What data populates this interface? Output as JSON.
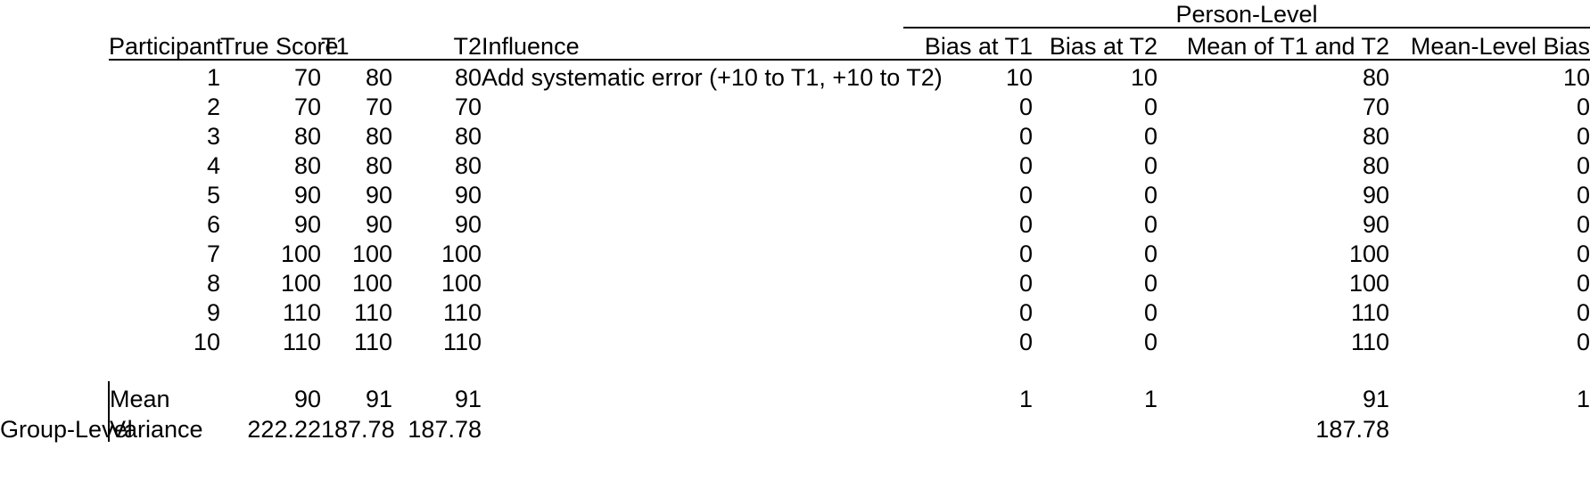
{
  "table": {
    "spanner": {
      "label": "Person-Level"
    },
    "columns": {
      "group_label": "",
      "participant": "Participant",
      "true_score": "True Score",
      "t1": "T1",
      "t2": "T2",
      "influence": "Influence",
      "bias_at_t1": "Bias at T1",
      "bias_at_t2": "Bias at T2",
      "mean_of_t1_and_t2": "Mean of T1 and T2",
      "mean_level_bias": "Mean-Level Bias"
    },
    "rows": [
      {
        "participant": "1",
        "true_score": "70",
        "t1": "80",
        "t2": "80",
        "influence": "Add systematic error (+10 to T1, +10 to T2)",
        "bias_at_t1": "10",
        "bias_at_t2": "10",
        "mean_of_t1_and_t2": "80",
        "mean_level_bias": "10"
      },
      {
        "participant": "2",
        "true_score": "70",
        "t1": "70",
        "t2": "70",
        "influence": "",
        "bias_at_t1": "0",
        "bias_at_t2": "0",
        "mean_of_t1_and_t2": "70",
        "mean_level_bias": "0"
      },
      {
        "participant": "3",
        "true_score": "80",
        "t1": "80",
        "t2": "80",
        "influence": "",
        "bias_at_t1": "0",
        "bias_at_t2": "0",
        "mean_of_t1_and_t2": "80",
        "mean_level_bias": "0"
      },
      {
        "participant": "4",
        "true_score": "80",
        "t1": "80",
        "t2": "80",
        "influence": "",
        "bias_at_t1": "0",
        "bias_at_t2": "0",
        "mean_of_t1_and_t2": "80",
        "mean_level_bias": "0"
      },
      {
        "participant": "5",
        "true_score": "90",
        "t1": "90",
        "t2": "90",
        "influence": "",
        "bias_at_t1": "0",
        "bias_at_t2": "0",
        "mean_of_t1_and_t2": "90",
        "mean_level_bias": "0"
      },
      {
        "participant": "6",
        "true_score": "90",
        "t1": "90",
        "t2": "90",
        "influence": "",
        "bias_at_t1": "0",
        "bias_at_t2": "0",
        "mean_of_t1_and_t2": "90",
        "mean_level_bias": "0"
      },
      {
        "participant": "7",
        "true_score": "100",
        "t1": "100",
        "t2": "100",
        "influence": "",
        "bias_at_t1": "0",
        "bias_at_t2": "0",
        "mean_of_t1_and_t2": "100",
        "mean_level_bias": "0"
      },
      {
        "participant": "8",
        "true_score": "100",
        "t1": "100",
        "t2": "100",
        "influence": "",
        "bias_at_t1": "0",
        "bias_at_t2": "0",
        "mean_of_t1_and_t2": "100",
        "mean_level_bias": "0"
      },
      {
        "participant": "9",
        "true_score": "110",
        "t1": "110",
        "t2": "110",
        "influence": "",
        "bias_at_t1": "0",
        "bias_at_t2": "0",
        "mean_of_t1_and_t2": "110",
        "mean_level_bias": "0"
      },
      {
        "participant": "10",
        "true_score": "110",
        "t1": "110",
        "t2": "110",
        "influence": "",
        "bias_at_t1": "0",
        "bias_at_t2": "0",
        "mean_of_t1_and_t2": "110",
        "mean_level_bias": "0"
      }
    ],
    "summary": {
      "group_label": "Group-Level",
      "rows": [
        {
          "label": "Mean",
          "true_score": "90",
          "t1": "91",
          "t2": "91",
          "influence": "",
          "bias_at_t1": "1",
          "bias_at_t2": "1",
          "mean_of_t1_and_t2": "91",
          "mean_level_bias": "1"
        },
        {
          "label": "Variance",
          "true_score": "222.22",
          "t1": "187.78",
          "t2": "187.78",
          "influence": "",
          "bias_at_t1": "",
          "bias_at_t2": "",
          "mean_of_t1_and_t2": "187.78",
          "mean_level_bias": ""
        }
      ]
    }
  },
  "colors": {
    "text": "#000000",
    "background": "#ffffff",
    "rule": "#000000"
  }
}
